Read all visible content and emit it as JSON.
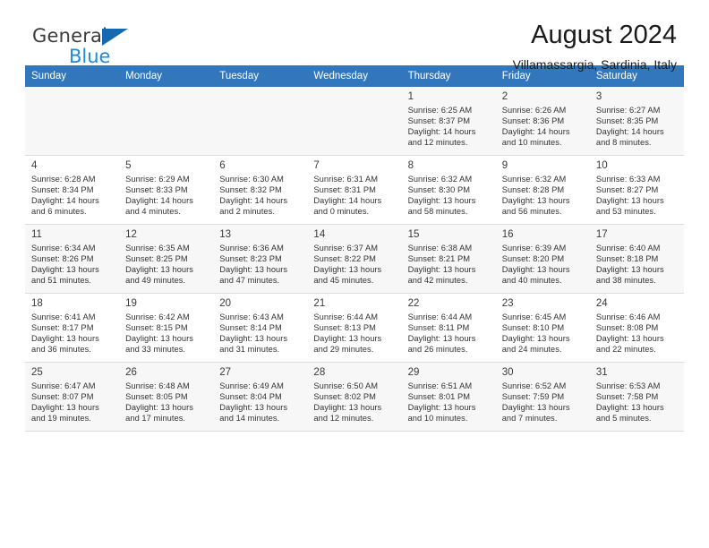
{
  "brand": {
    "name_part1": "General",
    "name_part2": "Blue",
    "triangle_color": "#1668b3",
    "blue_text_color": "#1f8ad6"
  },
  "header": {
    "title": "August 2024",
    "subtitle": "Villamassargia, Sardinia, Italy"
  },
  "theme": {
    "header_row_bg": "#3277bc",
    "header_row_text": "#ffffff",
    "alt_week_bg": "#f7f7f7",
    "grid_line": "#dddddd"
  },
  "weekday_headers": [
    "Sunday",
    "Monday",
    "Tuesday",
    "Wednesday",
    "Thursday",
    "Friday",
    "Saturday"
  ],
  "labels": {
    "sunrise_prefix": "Sunrise:",
    "sunset_prefix": "Sunset:",
    "daylight_prefix": "Daylight:"
  },
  "weeks": [
    {
      "shaded": true,
      "days": [
        {
          "blank": true
        },
        {
          "blank": true
        },
        {
          "blank": true
        },
        {
          "blank": true
        },
        {
          "day": "1",
          "sunrise": "Sunrise: 6:25 AM",
          "sunset": "Sunset: 8:37 PM",
          "daylight_line1": "Daylight: 14 hours",
          "daylight_line2": "and 12 minutes."
        },
        {
          "day": "2",
          "sunrise": "Sunrise: 6:26 AM",
          "sunset": "Sunset: 8:36 PM",
          "daylight_line1": "Daylight: 14 hours",
          "daylight_line2": "and 10 minutes."
        },
        {
          "day": "3",
          "sunrise": "Sunrise: 6:27 AM",
          "sunset": "Sunset: 8:35 PM",
          "daylight_line1": "Daylight: 14 hours",
          "daylight_line2": "and 8 minutes."
        }
      ]
    },
    {
      "shaded": false,
      "days": [
        {
          "day": "4",
          "sunrise": "Sunrise: 6:28 AM",
          "sunset": "Sunset: 8:34 PM",
          "daylight_line1": "Daylight: 14 hours",
          "daylight_line2": "and 6 minutes."
        },
        {
          "day": "5",
          "sunrise": "Sunrise: 6:29 AM",
          "sunset": "Sunset: 8:33 PM",
          "daylight_line1": "Daylight: 14 hours",
          "daylight_line2": "and 4 minutes."
        },
        {
          "day": "6",
          "sunrise": "Sunrise: 6:30 AM",
          "sunset": "Sunset: 8:32 PM",
          "daylight_line1": "Daylight: 14 hours",
          "daylight_line2": "and 2 minutes."
        },
        {
          "day": "7",
          "sunrise": "Sunrise: 6:31 AM",
          "sunset": "Sunset: 8:31 PM",
          "daylight_line1": "Daylight: 14 hours",
          "daylight_line2": "and 0 minutes."
        },
        {
          "day": "8",
          "sunrise": "Sunrise: 6:32 AM",
          "sunset": "Sunset: 8:30 PM",
          "daylight_line1": "Daylight: 13 hours",
          "daylight_line2": "and 58 minutes."
        },
        {
          "day": "9",
          "sunrise": "Sunrise: 6:32 AM",
          "sunset": "Sunset: 8:28 PM",
          "daylight_line1": "Daylight: 13 hours",
          "daylight_line2": "and 56 minutes."
        },
        {
          "day": "10",
          "sunrise": "Sunrise: 6:33 AM",
          "sunset": "Sunset: 8:27 PM",
          "daylight_line1": "Daylight: 13 hours",
          "daylight_line2": "and 53 minutes."
        }
      ]
    },
    {
      "shaded": true,
      "days": [
        {
          "day": "11",
          "sunrise": "Sunrise: 6:34 AM",
          "sunset": "Sunset: 8:26 PM",
          "daylight_line1": "Daylight: 13 hours",
          "daylight_line2": "and 51 minutes."
        },
        {
          "day": "12",
          "sunrise": "Sunrise: 6:35 AM",
          "sunset": "Sunset: 8:25 PM",
          "daylight_line1": "Daylight: 13 hours",
          "daylight_line2": "and 49 minutes."
        },
        {
          "day": "13",
          "sunrise": "Sunrise: 6:36 AM",
          "sunset": "Sunset: 8:23 PM",
          "daylight_line1": "Daylight: 13 hours",
          "daylight_line2": "and 47 minutes."
        },
        {
          "day": "14",
          "sunrise": "Sunrise: 6:37 AM",
          "sunset": "Sunset: 8:22 PM",
          "daylight_line1": "Daylight: 13 hours",
          "daylight_line2": "and 45 minutes."
        },
        {
          "day": "15",
          "sunrise": "Sunrise: 6:38 AM",
          "sunset": "Sunset: 8:21 PM",
          "daylight_line1": "Daylight: 13 hours",
          "daylight_line2": "and 42 minutes."
        },
        {
          "day": "16",
          "sunrise": "Sunrise: 6:39 AM",
          "sunset": "Sunset: 8:20 PM",
          "daylight_line1": "Daylight: 13 hours",
          "daylight_line2": "and 40 minutes."
        },
        {
          "day": "17",
          "sunrise": "Sunrise: 6:40 AM",
          "sunset": "Sunset: 8:18 PM",
          "daylight_line1": "Daylight: 13 hours",
          "daylight_line2": "and 38 minutes."
        }
      ]
    },
    {
      "shaded": false,
      "days": [
        {
          "day": "18",
          "sunrise": "Sunrise: 6:41 AM",
          "sunset": "Sunset: 8:17 PM",
          "daylight_line1": "Daylight: 13 hours",
          "daylight_line2": "and 36 minutes."
        },
        {
          "day": "19",
          "sunrise": "Sunrise: 6:42 AM",
          "sunset": "Sunset: 8:15 PM",
          "daylight_line1": "Daylight: 13 hours",
          "daylight_line2": "and 33 minutes."
        },
        {
          "day": "20",
          "sunrise": "Sunrise: 6:43 AM",
          "sunset": "Sunset: 8:14 PM",
          "daylight_line1": "Daylight: 13 hours",
          "daylight_line2": "and 31 minutes."
        },
        {
          "day": "21",
          "sunrise": "Sunrise: 6:44 AM",
          "sunset": "Sunset: 8:13 PM",
          "daylight_line1": "Daylight: 13 hours",
          "daylight_line2": "and 29 minutes."
        },
        {
          "day": "22",
          "sunrise": "Sunrise: 6:44 AM",
          "sunset": "Sunset: 8:11 PM",
          "daylight_line1": "Daylight: 13 hours",
          "daylight_line2": "and 26 minutes."
        },
        {
          "day": "23",
          "sunrise": "Sunrise: 6:45 AM",
          "sunset": "Sunset: 8:10 PM",
          "daylight_line1": "Daylight: 13 hours",
          "daylight_line2": "and 24 minutes."
        },
        {
          "day": "24",
          "sunrise": "Sunrise: 6:46 AM",
          "sunset": "Sunset: 8:08 PM",
          "daylight_line1": "Daylight: 13 hours",
          "daylight_line2": "and 22 minutes."
        }
      ]
    },
    {
      "shaded": true,
      "days": [
        {
          "day": "25",
          "sunrise": "Sunrise: 6:47 AM",
          "sunset": "Sunset: 8:07 PM",
          "daylight_line1": "Daylight: 13 hours",
          "daylight_line2": "and 19 minutes."
        },
        {
          "day": "26",
          "sunrise": "Sunrise: 6:48 AM",
          "sunset": "Sunset: 8:05 PM",
          "daylight_line1": "Daylight: 13 hours",
          "daylight_line2": "and 17 minutes."
        },
        {
          "day": "27",
          "sunrise": "Sunrise: 6:49 AM",
          "sunset": "Sunset: 8:04 PM",
          "daylight_line1": "Daylight: 13 hours",
          "daylight_line2": "and 14 minutes."
        },
        {
          "day": "28",
          "sunrise": "Sunrise: 6:50 AM",
          "sunset": "Sunset: 8:02 PM",
          "daylight_line1": "Daylight: 13 hours",
          "daylight_line2": "and 12 minutes."
        },
        {
          "day": "29",
          "sunrise": "Sunrise: 6:51 AM",
          "sunset": "Sunset: 8:01 PM",
          "daylight_line1": "Daylight: 13 hours",
          "daylight_line2": "and 10 minutes."
        },
        {
          "day": "30",
          "sunrise": "Sunrise: 6:52 AM",
          "sunset": "Sunset: 7:59 PM",
          "daylight_line1": "Daylight: 13 hours",
          "daylight_line2": "and 7 minutes."
        },
        {
          "day": "31",
          "sunrise": "Sunrise: 6:53 AM",
          "sunset": "Sunset: 7:58 PM",
          "daylight_line1": "Daylight: 13 hours",
          "daylight_line2": "and 5 minutes."
        }
      ]
    }
  ]
}
